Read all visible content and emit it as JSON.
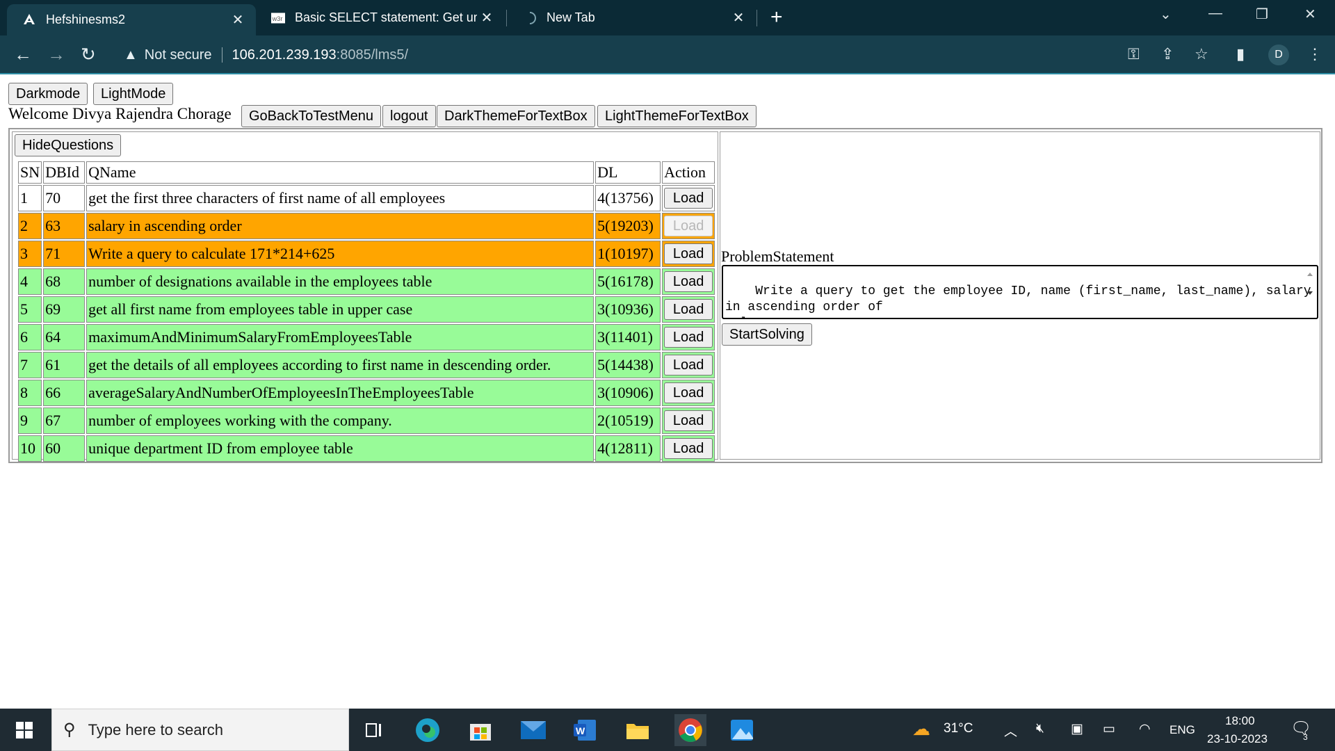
{
  "browser": {
    "tabs": [
      {
        "title": "Hefshinesms2",
        "favicon": "angular-icon"
      },
      {
        "title": "Basic SELECT statement: Get uni",
        "favicon": "w3r-icon"
      },
      {
        "title": "New Tab",
        "favicon": "loading-icon"
      }
    ],
    "address": {
      "security_label": "Not secure",
      "host": "106.201.239.193",
      "path": ":8085/lms5/"
    },
    "profile_initial": "D"
  },
  "page": {
    "theme_buttons": {
      "dark": "Darkmode",
      "light": "LightMode"
    },
    "welcome": "Welcome Divya Rajendra Chorage",
    "nav_buttons": {
      "back_to_test_menu": "GoBackToTestMenu",
      "logout": "logout",
      "dark_textbox": "DarkThemeForTextBox",
      "light_textbox": "LightThemeForTextBox"
    },
    "hide_questions": "HideQuestions",
    "table": {
      "headers": [
        "SN",
        "DBId",
        "QName",
        "DL",
        "Action"
      ],
      "rows": [
        {
          "sn": "1",
          "dbid": "70",
          "qname": "get the first three characters of first name of all employees",
          "dl": "4(13756)",
          "action": "Load",
          "status": "white"
        },
        {
          "sn": "2",
          "dbid": "63",
          "qname": "salary in ascending order",
          "dl": "5(19203)",
          "action": "Load",
          "status": "orange"
        },
        {
          "sn": "3",
          "dbid": "71",
          "qname": "Write a query to calculate 171*214+625",
          "dl": "1(10197)",
          "action": "Load",
          "status": "orange"
        },
        {
          "sn": "4",
          "dbid": "68",
          "qname": "number of designations available in the employees table",
          "dl": "5(16178)",
          "action": "Load",
          "status": "green"
        },
        {
          "sn": "5",
          "dbid": "69",
          "qname": "get all first name from employees table in upper case",
          "dl": "3(10936)",
          "action": "Load",
          "status": "green"
        },
        {
          "sn": "6",
          "dbid": "64",
          "qname": "maximumAndMinimumSalaryFromEmployeesTable",
          "dl": "3(11401)",
          "action": "Load",
          "status": "green"
        },
        {
          "sn": "7",
          "dbid": "61",
          "qname": "get the details of all employees according to first name in descending order.",
          "dl": "5(14438)",
          "action": "Load",
          "status": "green"
        },
        {
          "sn": "8",
          "dbid": "66",
          "qname": "averageSalaryAndNumberOfEmployeesInTheEmployeesTable",
          "dl": "3(10906)",
          "action": "Load",
          "status": "green"
        },
        {
          "sn": "9",
          "dbid": "67",
          "qname": "number of employees working with the company.",
          "dl": "2(10519)",
          "action": "Load",
          "status": "green"
        },
        {
          "sn": "10",
          "dbid": "60",
          "qname": "unique department ID from employee table",
          "dl": "4(12811)",
          "action": "Load",
          "status": "green"
        }
      ]
    },
    "problem": {
      "label": "ProblemStatement",
      "text": "Write a query to get the employee ID, name (first_name, last_name), salary\nin ascending order of\nsalary."
    },
    "start_solving": "StartSolving"
  },
  "colors": {
    "orange_row": "#ffa500",
    "green_row": "#98fb98",
    "chrome_dark": "#0b2a36",
    "chrome_toolbar": "#173f4d"
  },
  "taskbar": {
    "search_placeholder": "Type here to search",
    "weather": "31°C",
    "language": "ENG",
    "time": "18:00",
    "date": "23-10-2023",
    "notification_count": "3"
  }
}
